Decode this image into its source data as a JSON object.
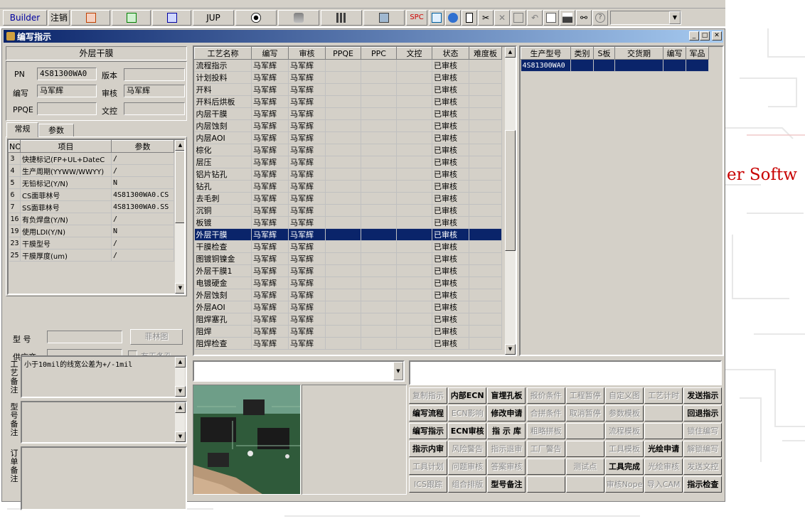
{
  "toolbar": {
    "builder_label": "Builder",
    "logout_label": "注销",
    "jup_label": "JUP",
    "spc_label": "SPC"
  },
  "background": {
    "text": "er Softw"
  },
  "window": {
    "title": "编写指示"
  },
  "left": {
    "section_title": "外层干膜",
    "pn_label": "PN",
    "pn_value": "4S81300WA0",
    "version_label": "版本",
    "version_value": "",
    "writer_label": "编写",
    "writer_value": "马军辉",
    "reviewer_label": "审核",
    "reviewer_value": "马军辉",
    "ppqe_label": "PPQE",
    "ppqe_value": "",
    "doc_control_label": "文控",
    "doc_control_value": "",
    "tabs": [
      "常规",
      "参数"
    ],
    "param_headers": [
      "NO",
      "项目",
      "参数"
    ],
    "params": [
      {
        "no": "3",
        "item": "快捷标记(FP+UL+DateC",
        "value": "/"
      },
      {
        "no": "4",
        "item": "生产周期(YYWW/WWYY)",
        "value": "/"
      },
      {
        "no": "5",
        "item": "无铅标记(Y/N)",
        "value": "N"
      },
      {
        "no": "6",
        "item": "CS面菲林号",
        "value": "4S81300WA0.CS"
      },
      {
        "no": "7",
        "item": "SS面菲林号",
        "value": "4S81300WA0.SS"
      },
      {
        "no": "16",
        "item": "有负焊盘(Y/N)",
        "value": "/"
      },
      {
        "no": "19",
        "item": "使用LDI(Y/N)",
        "value": "N"
      },
      {
        "no": "23",
        "item": "干膜型号",
        "value": "/"
      },
      {
        "no": "25",
        "item": "干膜厚度(um)",
        "value": "/"
      }
    ],
    "model_label": "型  号",
    "model_value": "",
    "film_button": "菲林图",
    "supplier_label": "供应商",
    "supplier_value": "",
    "no_strip_label": "有无条孔",
    "process_note_label": "工艺备注",
    "process_note_text": "小于10mil的线宽公差为+/-1mil",
    "model_note_label": "型号备注",
    "order_note_label": "订单备注"
  },
  "process_table": {
    "headers": [
      "工艺名称",
      "编写",
      "审核",
      "PPQE",
      "PPC",
      "文控",
      "状态",
      "难度板"
    ],
    "rows": [
      [
        "流程指示",
        "马军辉",
        "马军辉",
        "",
        "",
        "",
        "已审核",
        ""
      ],
      [
        "计划投料",
        "马军辉",
        "马军辉",
        "",
        "",
        "",
        "已审核",
        ""
      ],
      [
        "开料",
        "马军辉",
        "马军辉",
        "",
        "",
        "",
        "已审核",
        ""
      ],
      [
        "开料后烘板",
        "马军辉",
        "马军辉",
        "",
        "",
        "",
        "已审核",
        ""
      ],
      [
        "内层干膜",
        "马军辉",
        "马军辉",
        "",
        "",
        "",
        "已审核",
        ""
      ],
      [
        "内层蚀刻",
        "马军辉",
        "马军辉",
        "",
        "",
        "",
        "已审核",
        ""
      ],
      [
        "内层AOI",
        "马军辉",
        "马军辉",
        "",
        "",
        "",
        "已审核",
        ""
      ],
      [
        "棕化",
        "马军辉",
        "马军辉",
        "",
        "",
        "",
        "已审核",
        ""
      ],
      [
        "层压",
        "马军辉",
        "马军辉",
        "",
        "",
        "",
        "已审核",
        ""
      ],
      [
        "铝片钻孔",
        "马军辉",
        "马军辉",
        "",
        "",
        "",
        "已审核",
        ""
      ],
      [
        "钻孔",
        "马军辉",
        "马军辉",
        "",
        "",
        "",
        "已审核",
        ""
      ],
      [
        "去毛刺",
        "马军辉",
        "马军辉",
        "",
        "",
        "",
        "已审核",
        ""
      ],
      [
        "沉铜",
        "马军辉",
        "马军辉",
        "",
        "",
        "",
        "已审核",
        ""
      ],
      [
        "板镀",
        "马军辉",
        "马军辉",
        "",
        "",
        "",
        "已审核",
        ""
      ],
      [
        "外层干膜",
        "马军辉",
        "马军辉",
        "",
        "",
        "",
        "已审核",
        ""
      ],
      [
        "干膜检查",
        "马军辉",
        "马军辉",
        "",
        "",
        "",
        "已审核",
        ""
      ],
      [
        "图镀铜镍金",
        "马军辉",
        "马军辉",
        "",
        "",
        "",
        "已审核",
        ""
      ],
      [
        "外层干膜1",
        "马军辉",
        "马军辉",
        "",
        "",
        "",
        "已审核",
        ""
      ],
      [
        "电镀硬金",
        "马军辉",
        "马军辉",
        "",
        "",
        "",
        "已审核",
        ""
      ],
      [
        "外层蚀刻",
        "马军辉",
        "马军辉",
        "",
        "",
        "",
        "已审核",
        ""
      ],
      [
        "外层AOI",
        "马军辉",
        "马军辉",
        "",
        "",
        "",
        "已审核",
        ""
      ],
      [
        "阻焊塞孔",
        "马军辉",
        "马军辉",
        "",
        "",
        "",
        "已审核",
        ""
      ],
      [
        "阻焊",
        "马军辉",
        "马军辉",
        "",
        "",
        "",
        "已审核",
        ""
      ],
      [
        "阻焊检查",
        "马军辉",
        "马军辉",
        "",
        "",
        "",
        "已审核",
        ""
      ]
    ],
    "selected_index": 14
  },
  "right_table": {
    "headers": [
      "生产型号",
      "类别",
      "S板",
      "交货期",
      "编写",
      "军品"
    ],
    "rows": [
      [
        "4S81300WA0",
        "",
        "",
        "",
        "",
        ""
      ]
    ]
  },
  "buttons": [
    {
      "label": "复制指示",
      "enabled": false
    },
    {
      "label": "内部ECN",
      "enabled": true
    },
    {
      "label": "盲埋孔板",
      "enabled": true
    },
    {
      "label": "报价条件",
      "enabled": false
    },
    {
      "label": "工程暂停",
      "enabled": false
    },
    {
      "label": "自定义图",
      "enabled": false
    },
    {
      "label": "工艺计时",
      "enabled": false
    },
    {
      "label": "发送指示",
      "enabled": true
    },
    {
      "label": "编写流程",
      "enabled": true
    },
    {
      "label": "ECN影响",
      "enabled": false
    },
    {
      "label": "修改申请",
      "enabled": true
    },
    {
      "label": "合拼条件",
      "enabled": false
    },
    {
      "label": "取消暂停",
      "enabled": false
    },
    {
      "label": "参数模板",
      "enabled": false
    },
    {
      "label": "",
      "enabled": false
    },
    {
      "label": "回退指示",
      "enabled": true
    },
    {
      "label": "编写指示",
      "enabled": true
    },
    {
      "label": "ECN审核",
      "enabled": true
    },
    {
      "label": "指 示 库",
      "enabled": true
    },
    {
      "label": "粗略拼板",
      "enabled": false
    },
    {
      "label": "",
      "enabled": false
    },
    {
      "label": "流程模板",
      "enabled": false
    },
    {
      "label": "",
      "enabled": false
    },
    {
      "label": "锁住编写",
      "enabled": false
    },
    {
      "label": "指示内审",
      "enabled": true
    },
    {
      "label": "风险警告",
      "enabled": false
    },
    {
      "label": "指示退审",
      "enabled": false
    },
    {
      "label": "工厂警告",
      "enabled": false
    },
    {
      "label": "",
      "enabled": false
    },
    {
      "label": "工具模板",
      "enabled": false
    },
    {
      "label": "光绘申请",
      "enabled": true
    },
    {
      "label": "解锁编写",
      "enabled": false
    },
    {
      "label": "工具计划",
      "enabled": false
    },
    {
      "label": "问题审核",
      "enabled": false
    },
    {
      "label": "答案审核",
      "enabled": false
    },
    {
      "label": "",
      "enabled": false
    },
    {
      "label": "测试点",
      "enabled": false
    },
    {
      "label": "工具完成",
      "enabled": true
    },
    {
      "label": "光绘审核",
      "enabled": false
    },
    {
      "label": "发送文控",
      "enabled": false
    },
    {
      "label": "ICS跟踪",
      "enabled": false
    },
    {
      "label": "组合排版",
      "enabled": false
    },
    {
      "label": "型号备注",
      "enabled": true
    },
    {
      "label": "",
      "enabled": false
    },
    {
      "label": "",
      "enabled": false
    },
    {
      "label": "审核Nope",
      "enabled": false
    },
    {
      "label": "导入CAM",
      "enabled": false
    },
    {
      "label": "指示检查",
      "enabled": true
    }
  ]
}
